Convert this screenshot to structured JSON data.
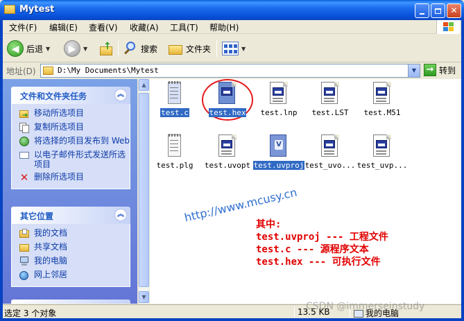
{
  "window": {
    "title": "Mytest",
    "controls": [
      "minimize",
      "maximize",
      "close"
    ]
  },
  "menu": [
    "文件(F)",
    "编辑(E)",
    "查看(V)",
    "收藏(A)",
    "工具(T)",
    "帮助(H)"
  ],
  "toolbar": {
    "back_label": "后退",
    "search_label": "搜索",
    "folders_label": "文件夹"
  },
  "address": {
    "label": "地址(D)",
    "path": "D:\\My Documents\\Mytest",
    "go_label": "转到"
  },
  "tasks_panel": {
    "title": "文件和文件夹任务",
    "items": [
      {
        "label": "移动所选项目",
        "icon": "move-icon"
      },
      {
        "label": "复制所选项目",
        "icon": "copy-icon"
      },
      {
        "label": "将选择的项目发布到 Web",
        "icon": "web-publish-icon"
      },
      {
        "label": "以电子邮件形式发送所选项目",
        "icon": "email-icon"
      },
      {
        "label": "删除所选项目",
        "icon": "delete-icon"
      }
    ]
  },
  "places_panel": {
    "title": "其它位置",
    "items": [
      {
        "label": "我的文档",
        "icon": "my-documents-icon"
      },
      {
        "label": "共享文档",
        "icon": "shared-documents-icon"
      },
      {
        "label": "我的电脑",
        "icon": "my-computer-icon"
      },
      {
        "label": "网上邻居",
        "icon": "network-places-icon"
      }
    ]
  },
  "files": [
    {
      "name": "test.c",
      "icon": "notepad-file-icon",
      "selected": true
    },
    {
      "name": "test.hex",
      "icon": "generic-file-icon",
      "selected": true
    },
    {
      "name": "test.lnp",
      "icon": "generic-file-icon",
      "selected": false
    },
    {
      "name": "test.LST",
      "icon": "generic-file-icon",
      "selected": false
    },
    {
      "name": "test.M51",
      "icon": "generic-file-icon",
      "selected": false
    },
    {
      "name": "test.plg",
      "icon": "notepad-file-icon",
      "selected": false
    },
    {
      "name": "test.uvopt",
      "icon": "generic-file-icon",
      "selected": false
    },
    {
      "name": "test.uvproj",
      "icon": "uvision-project-icon",
      "selected": true
    },
    {
      "name": "test_uvo...",
      "icon": "generic-file-icon",
      "selected": false
    },
    {
      "name": "test_uvp...",
      "icon": "generic-file-icon",
      "selected": false
    }
  ],
  "annotation": {
    "watermark": "http://www.mcusy.cn",
    "lines": [
      "其中:",
      "test.uvproj --- 工程文件",
      "test.c --- 源程序文本",
      "test.hex --- 可执行文件"
    ]
  },
  "status": {
    "selection": "选定 3 个对象",
    "size": "13.5 KB",
    "location": "我的电脑"
  },
  "csdn_watermark": "CSDN @immerseinstudy"
}
